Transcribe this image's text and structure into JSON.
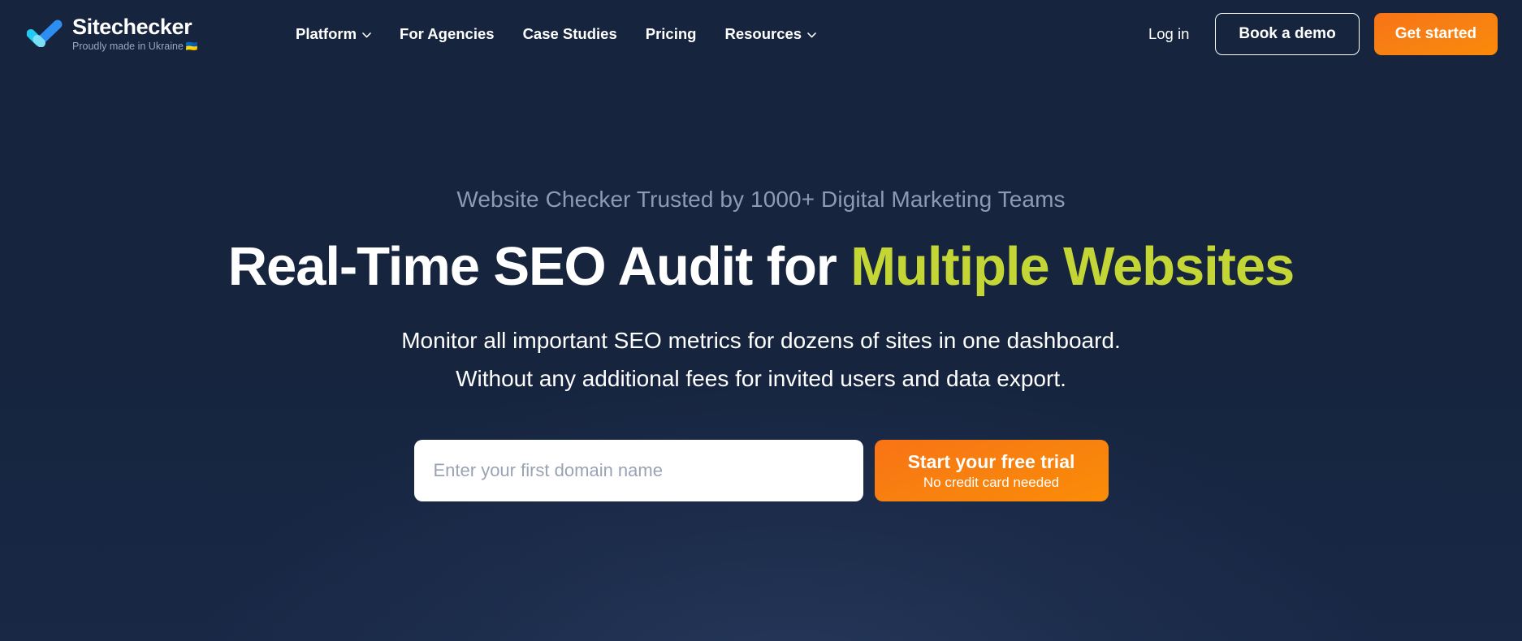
{
  "brand": {
    "name": "Sitechecker",
    "tagline": "Proudly made in Ukraine",
    "flag": "🇺🇦",
    "logo_icon": "checkmark-icon",
    "logo_color_left": "#22c9f0",
    "logo_color_right": "#2b8ef0"
  },
  "header": {
    "nav": [
      {
        "label": "Platform",
        "has_dropdown": true,
        "icon": "chevron-down-icon"
      },
      {
        "label": "For Agencies",
        "has_dropdown": false
      },
      {
        "label": "Case Studies",
        "has_dropdown": false
      },
      {
        "label": "Pricing",
        "has_dropdown": false
      },
      {
        "label": "Resources",
        "has_dropdown": true,
        "icon": "chevron-down-icon"
      }
    ],
    "login_label": "Log in",
    "demo_label": "Book a demo",
    "get_started_label": "Get started"
  },
  "hero": {
    "eyebrow": "Website Checker Trusted by 1000+ Digital Marketing Teams",
    "title_part1": "Real-Time SEO Audit for ",
    "title_accent": "Multiple Websites",
    "subtitle_line1": "Monitor all important SEO metrics for dozens of sites in one dashboard.",
    "subtitle_line2": "Without any additional fees for invited users and data export.",
    "form": {
      "input_value": "",
      "input_placeholder": "Enter your first domain name",
      "submit_label": "Start your free trial",
      "submit_sublabel": "No credit card needed"
    }
  },
  "colors": {
    "background": "#16243e",
    "accent_lime": "#c3d636",
    "accent_orange": "#f97316",
    "muted_text": "#8d9bb2"
  }
}
